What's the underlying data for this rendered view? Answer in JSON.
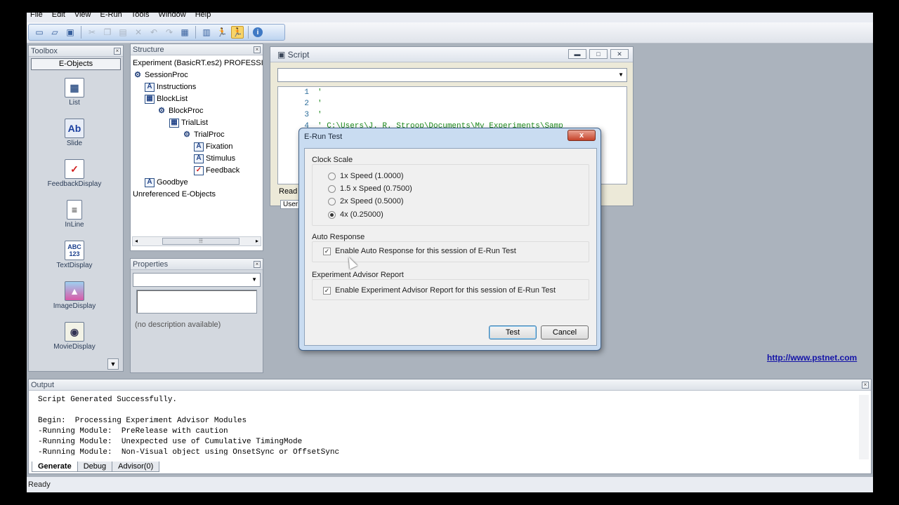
{
  "menu": [
    "File",
    "Edit",
    "View",
    "E-Run",
    "Tools",
    "Window",
    "Help"
  ],
  "toolbar": {
    "icons": [
      "new-icon",
      "open-icon",
      "save-icon",
      "cut-icon",
      "copy-icon",
      "paste-icon",
      "delete-icon",
      "undo-icon",
      "redo-icon",
      "properties-icon",
      "generate-icon",
      "run-icon",
      "test-icon",
      "info-icon"
    ]
  },
  "toolbox": {
    "title": "Toolbox",
    "category": "E-Objects",
    "items": [
      "List",
      "Slide",
      "FeedbackDisplay",
      "InLine",
      "TextDisplay",
      "ImageDisplay",
      "MovieDisplay"
    ]
  },
  "structure": {
    "title": "Structure",
    "root": "Experiment (BasicRT.es2) PROFESSIO",
    "nodes": [
      "SessionProc",
      "Instructions",
      "BlockList",
      "BlockProc",
      "TrialList",
      "TrialProc",
      "Fixation",
      "Stimulus",
      "Feedback",
      "Goodbye"
    ],
    "unreferenced": "Unreferenced E-Objects"
  },
  "properties": {
    "title": "Properties",
    "description": "(no description available)"
  },
  "script": {
    "title": "Script",
    "lines": [
      {
        "num": "1",
        "text": "'"
      },
      {
        "num": "2",
        "text": "'"
      },
      {
        "num": "3",
        "text": "'"
      },
      {
        "num": "4",
        "text": "'   C:\\Users\\J. R. Stroop\\Documents\\My Experiments\\Samp"
      }
    ],
    "status_partial": "Read",
    "tab_partial": "User"
  },
  "dialog": {
    "title": "E-Run Test",
    "close": "x",
    "clock_scale_label": "Clock Scale",
    "clock_options": [
      "1x Speed (1.0000)",
      "1.5 x Speed (0.7500)",
      "2x Speed (0.5000)",
      "4x (0.25000)"
    ],
    "clock_selected_index": 3,
    "auto_response_label": "Auto Response",
    "auto_response_option": "Enable Auto Response for this session of E-Run Test",
    "auto_response_checked": true,
    "advisor_label": "Experiment Advisor Report",
    "advisor_option": "Enable Experiment Advisor Report for this session of E-Run Test",
    "advisor_checked": true,
    "test_button": "Test",
    "cancel_button": "Cancel"
  },
  "link": "http://www.pstnet.com",
  "output": {
    "title": "Output",
    "lines": [
      "Script Generated Successfully.",
      "",
      "Begin:  Processing Experiment Advisor Modules",
      "-Running Module:  PreRelease with caution",
      "-Running Module:  Unexpected use of Cumulative TimingMode",
      "-Running Module:  Non-Visual object using OnsetSync or OffsetSync"
    ],
    "tabs": [
      "Generate",
      "Debug",
      "Advisor(0)"
    ]
  },
  "status": "Ready"
}
